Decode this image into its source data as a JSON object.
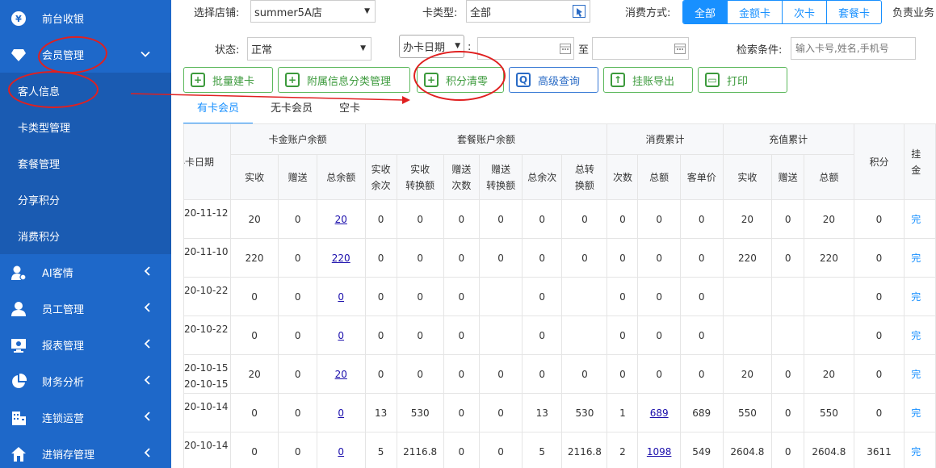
{
  "sidebar": {
    "items": [
      {
        "label": "前台收银",
        "icon": "yen-icon"
      },
      {
        "label": "会员管理",
        "icon": "diamond-icon",
        "expanded": true
      },
      {
        "label": "AI客情",
        "icon": "user-gear-icon"
      },
      {
        "label": "员工管理",
        "icon": "user-icon"
      },
      {
        "label": "报表管理",
        "icon": "monitor-icon"
      },
      {
        "label": "财务分析",
        "icon": "pie-chart-icon"
      },
      {
        "label": "连锁运营",
        "icon": "building-icon"
      },
      {
        "label": "进销存管理",
        "icon": "home-icon"
      }
    ],
    "subitems": [
      "客人信息",
      "卡类型管理",
      "套餐管理",
      "分享积分",
      "消费积分"
    ]
  },
  "filters": {
    "store_label": "选择店铺:",
    "store_value": "summer5A店",
    "cardtype_label": "卡类型:",
    "cardtype_value": "全部",
    "paymode_label": "消费方式:",
    "paymode_options": [
      "全部",
      "金额卡",
      "次卡",
      "套餐卡"
    ],
    "owner_label": "负责业务",
    "status_label": "状态:",
    "status_value": "正常",
    "date_type_value": "办卡日期",
    "date_colon": ":",
    "date_to": "至",
    "search_label": "检索条件:",
    "search_placeholder": "输入卡号,姓名,手机号"
  },
  "toolbar": {
    "batch_create": "批量建卡",
    "attr_category": "附属信息分类管理",
    "points_clear": "积分清零",
    "advanced_query": "高级查询",
    "export_account": "挂账导出",
    "print": "打印"
  },
  "tabs": [
    "有卡会员",
    "无卡会员",
    "空卡"
  ],
  "table": {
    "col_date": "办卡日期",
    "group_card": "卡金账户余额",
    "group_package": "套餐账户余额",
    "group_consume": "消费累计",
    "group_recharge": "充值累计",
    "col_points": "积分",
    "col_last": "挂",
    "col_last2": "金",
    "sub_card": [
      "实收",
      "赠送",
      "总余额"
    ],
    "sub_package": [
      "实收\n余次",
      "实收\n转换额",
      "赠送\n次数",
      "赠送\n转换额",
      "总余次",
      "总转\n换额"
    ],
    "sub_consume": [
      "次数",
      "总额",
      "客单价"
    ],
    "sub_recharge": [
      "实收",
      "赠送",
      "总额"
    ],
    "rows": [
      {
        "date": "20-11-12",
        "date2": "",
        "c": [
          "20",
          "0",
          "20"
        ],
        "p": [
          "0",
          "0",
          "0",
          "0",
          "0",
          "0"
        ],
        "s": [
          "0",
          "0",
          "0"
        ],
        "r": [
          "20",
          "0",
          "20"
        ],
        "pts": "0",
        "x": "完"
      },
      {
        "date": "20-11-10",
        "date2": "",
        "c": [
          "220",
          "0",
          "220"
        ],
        "p": [
          "0",
          "0",
          "0",
          "0",
          "0",
          "0"
        ],
        "s": [
          "0",
          "0",
          "0"
        ],
        "r": [
          "220",
          "0",
          "220"
        ],
        "pts": "0",
        "x": "完"
      },
      {
        "date": "20-10-22",
        "date2": "",
        "c": [
          "0",
          "0",
          "0"
        ],
        "p": [
          "0",
          "0",
          "0",
          "",
          "0",
          ""
        ],
        "s": [
          "0",
          "0",
          "0"
        ],
        "r": [
          "",
          "",
          ""
        ],
        "pts": "0",
        "x": "完"
      },
      {
        "date": "20-10-22",
        "date2": "",
        "c": [
          "0",
          "0",
          "0"
        ],
        "p": [
          "0",
          "0",
          "0",
          "",
          "0",
          ""
        ],
        "s": [
          "0",
          "0",
          "0"
        ],
        "r": [
          "",
          "",
          ""
        ],
        "pts": "0",
        "x": "完"
      },
      {
        "date": "20-10-15",
        "date2": "20-10-15",
        "c": [
          "20",
          "0",
          "20"
        ],
        "p": [
          "0",
          "0",
          "0",
          "0",
          "0",
          "0"
        ],
        "s": [
          "0",
          "0",
          "0"
        ],
        "r": [
          "20",
          "0",
          "20"
        ],
        "pts": "0",
        "x": "完"
      },
      {
        "date": "20-10-14",
        "date2": "",
        "c": [
          "0",
          "0",
          "0"
        ],
        "p": [
          "13",
          "530",
          "0",
          "0",
          "13",
          "530"
        ],
        "s": [
          "1",
          "689",
          "689"
        ],
        "r": [
          "550",
          "0",
          "550"
        ],
        "pts": "0",
        "x": "完"
      },
      {
        "date": "20-10-14",
        "date2": "",
        "c": [
          "0",
          "0",
          "0"
        ],
        "p": [
          "5",
          "2116.8",
          "0",
          "0",
          "5",
          "2116.8"
        ],
        "s": [
          "2",
          "1098",
          "549"
        ],
        "r": [
          "2604.8",
          "0",
          "2604.8"
        ],
        "pts": "3611",
        "x": "完"
      }
    ]
  },
  "colors": {
    "sidebar": "#1e68c9",
    "accent": "#1890ff",
    "green": "#5cb85c",
    "annotation": "#e02020"
  }
}
